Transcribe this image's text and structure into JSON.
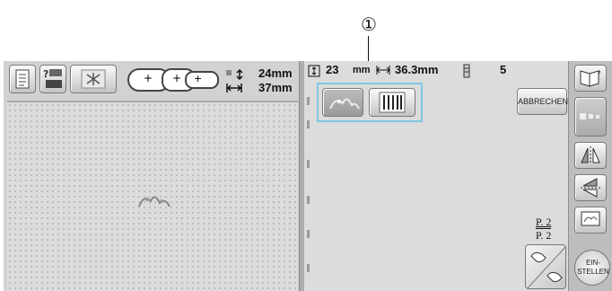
{
  "callout": {
    "number": "①"
  },
  "toolbar": {
    "left_buttons": [
      "file-list-icon",
      "sewing-machine-icon",
      "grid-pattern-icon"
    ],
    "frame_sizes": [
      "+",
      "+",
      "+"
    ],
    "size_height": "24mm",
    "size_width": "37mm"
  },
  "info_bar": {
    "height_value": "23",
    "height_unit": "mm",
    "width_value": "36.3mm",
    "color_count": "5"
  },
  "abbrechen_label": "ABBRECHEN",
  "page_indicator": {
    "current": "P. 2",
    "total": "P. 2"
  },
  "einstellen_label": "EIN-\nSTELLEN",
  "colors": {
    "screen_bg": "#d2d2d2",
    "callout_box": "#7fc6e2",
    "pane_bg": "#dcdcdc"
  }
}
